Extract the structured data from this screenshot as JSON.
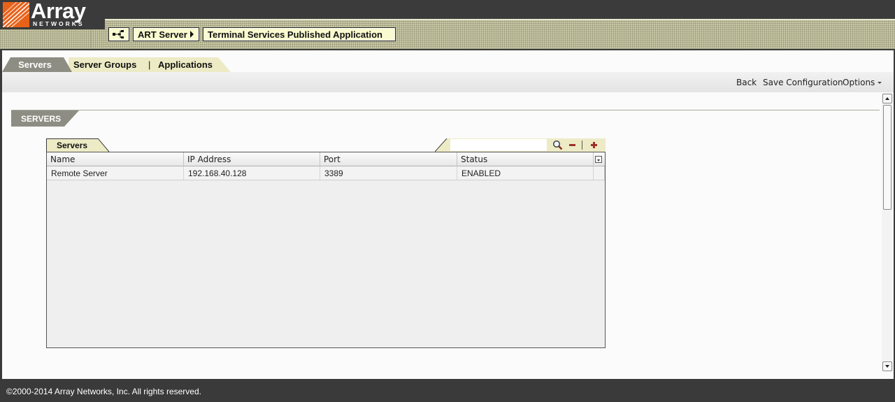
{
  "header": {
    "logo_text": "Array",
    "logo_sub": "NETWORKS",
    "breadcrumb": [
      {
        "label": "ART Server"
      },
      {
        "label": "Terminal Services Published Application"
      }
    ],
    "icon": "network-tree-icon"
  },
  "tabs": [
    {
      "label": "Servers",
      "active": true
    },
    {
      "label": "Server Groups",
      "active": false
    },
    {
      "label": "Applications",
      "active": false
    }
  ],
  "tab_separator": "|",
  "toolbar": {
    "back": "Back",
    "save": "Save Configuration",
    "options": "Options"
  },
  "section": {
    "title": "SERVERS"
  },
  "grid": {
    "tab_label": "Servers",
    "tools": [
      "search-icon",
      "remove-icon",
      "add-icon"
    ],
    "columns": [
      "Name",
      "IP Address",
      "Port",
      "Status"
    ],
    "rows": [
      [
        "Remote Server",
        "192.168.40.128",
        "3389",
        "ENABLED"
      ]
    ]
  },
  "footer": {
    "copyright": "©2000-2014 Array Networks, Inc. All rights reserved."
  },
  "colors": {
    "accent_tab": "#8d8d83",
    "tab_bar": "#ecebc5",
    "header_pattern": "#c8c8a6",
    "logo_orange": "#e8621a",
    "action_red": "#a0302a"
  }
}
